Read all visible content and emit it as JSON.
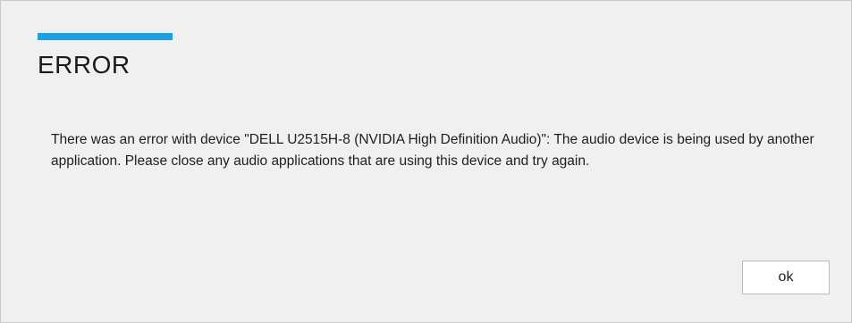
{
  "dialog": {
    "title": "ERROR",
    "message": "There was an error with device \"DELL U2515H-8 (NVIDIA High Definition Audio)\": The audio device is being used by another application. Please close any audio applications that are using this device and try again.",
    "ok_label": "ok"
  },
  "colors": {
    "accent": "#1ba1e2",
    "background": "#f0f0f0"
  }
}
